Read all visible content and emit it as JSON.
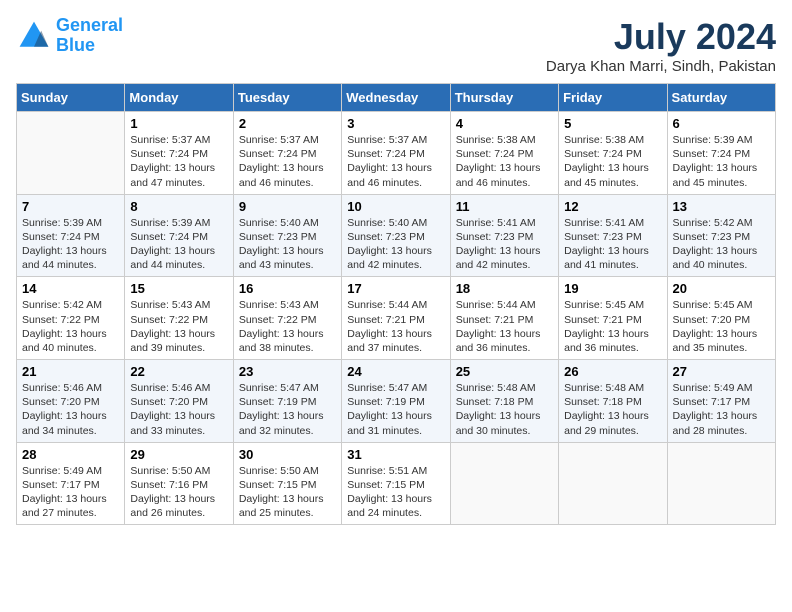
{
  "header": {
    "logo_line1": "General",
    "logo_line2": "Blue",
    "month": "July 2024",
    "location": "Darya Khan Marri, Sindh, Pakistan"
  },
  "weekdays": [
    "Sunday",
    "Monday",
    "Tuesday",
    "Wednesday",
    "Thursday",
    "Friday",
    "Saturday"
  ],
  "weeks": [
    [
      {
        "day": "",
        "info": ""
      },
      {
        "day": "1",
        "info": "Sunrise: 5:37 AM\nSunset: 7:24 PM\nDaylight: 13 hours\nand 47 minutes."
      },
      {
        "day": "2",
        "info": "Sunrise: 5:37 AM\nSunset: 7:24 PM\nDaylight: 13 hours\nand 46 minutes."
      },
      {
        "day": "3",
        "info": "Sunrise: 5:37 AM\nSunset: 7:24 PM\nDaylight: 13 hours\nand 46 minutes."
      },
      {
        "day": "4",
        "info": "Sunrise: 5:38 AM\nSunset: 7:24 PM\nDaylight: 13 hours\nand 46 minutes."
      },
      {
        "day": "5",
        "info": "Sunrise: 5:38 AM\nSunset: 7:24 PM\nDaylight: 13 hours\nand 45 minutes."
      },
      {
        "day": "6",
        "info": "Sunrise: 5:39 AM\nSunset: 7:24 PM\nDaylight: 13 hours\nand 45 minutes."
      }
    ],
    [
      {
        "day": "7",
        "info": "Sunrise: 5:39 AM\nSunset: 7:24 PM\nDaylight: 13 hours\nand 44 minutes."
      },
      {
        "day": "8",
        "info": "Sunrise: 5:39 AM\nSunset: 7:24 PM\nDaylight: 13 hours\nand 44 minutes."
      },
      {
        "day": "9",
        "info": "Sunrise: 5:40 AM\nSunset: 7:23 PM\nDaylight: 13 hours\nand 43 minutes."
      },
      {
        "day": "10",
        "info": "Sunrise: 5:40 AM\nSunset: 7:23 PM\nDaylight: 13 hours\nand 42 minutes."
      },
      {
        "day": "11",
        "info": "Sunrise: 5:41 AM\nSunset: 7:23 PM\nDaylight: 13 hours\nand 42 minutes."
      },
      {
        "day": "12",
        "info": "Sunrise: 5:41 AM\nSunset: 7:23 PM\nDaylight: 13 hours\nand 41 minutes."
      },
      {
        "day": "13",
        "info": "Sunrise: 5:42 AM\nSunset: 7:23 PM\nDaylight: 13 hours\nand 40 minutes."
      }
    ],
    [
      {
        "day": "14",
        "info": "Sunrise: 5:42 AM\nSunset: 7:22 PM\nDaylight: 13 hours\nand 40 minutes."
      },
      {
        "day": "15",
        "info": "Sunrise: 5:43 AM\nSunset: 7:22 PM\nDaylight: 13 hours\nand 39 minutes."
      },
      {
        "day": "16",
        "info": "Sunrise: 5:43 AM\nSunset: 7:22 PM\nDaylight: 13 hours\nand 38 minutes."
      },
      {
        "day": "17",
        "info": "Sunrise: 5:44 AM\nSunset: 7:21 PM\nDaylight: 13 hours\nand 37 minutes."
      },
      {
        "day": "18",
        "info": "Sunrise: 5:44 AM\nSunset: 7:21 PM\nDaylight: 13 hours\nand 36 minutes."
      },
      {
        "day": "19",
        "info": "Sunrise: 5:45 AM\nSunset: 7:21 PM\nDaylight: 13 hours\nand 36 minutes."
      },
      {
        "day": "20",
        "info": "Sunrise: 5:45 AM\nSunset: 7:20 PM\nDaylight: 13 hours\nand 35 minutes."
      }
    ],
    [
      {
        "day": "21",
        "info": "Sunrise: 5:46 AM\nSunset: 7:20 PM\nDaylight: 13 hours\nand 34 minutes."
      },
      {
        "day": "22",
        "info": "Sunrise: 5:46 AM\nSunset: 7:20 PM\nDaylight: 13 hours\nand 33 minutes."
      },
      {
        "day": "23",
        "info": "Sunrise: 5:47 AM\nSunset: 7:19 PM\nDaylight: 13 hours\nand 32 minutes."
      },
      {
        "day": "24",
        "info": "Sunrise: 5:47 AM\nSunset: 7:19 PM\nDaylight: 13 hours\nand 31 minutes."
      },
      {
        "day": "25",
        "info": "Sunrise: 5:48 AM\nSunset: 7:18 PM\nDaylight: 13 hours\nand 30 minutes."
      },
      {
        "day": "26",
        "info": "Sunrise: 5:48 AM\nSunset: 7:18 PM\nDaylight: 13 hours\nand 29 minutes."
      },
      {
        "day": "27",
        "info": "Sunrise: 5:49 AM\nSunset: 7:17 PM\nDaylight: 13 hours\nand 28 minutes."
      }
    ],
    [
      {
        "day": "28",
        "info": "Sunrise: 5:49 AM\nSunset: 7:17 PM\nDaylight: 13 hours\nand 27 minutes."
      },
      {
        "day": "29",
        "info": "Sunrise: 5:50 AM\nSunset: 7:16 PM\nDaylight: 13 hours\nand 26 minutes."
      },
      {
        "day": "30",
        "info": "Sunrise: 5:50 AM\nSunset: 7:15 PM\nDaylight: 13 hours\nand 25 minutes."
      },
      {
        "day": "31",
        "info": "Sunrise: 5:51 AM\nSunset: 7:15 PM\nDaylight: 13 hours\nand 24 minutes."
      },
      {
        "day": "",
        "info": ""
      },
      {
        "day": "",
        "info": ""
      },
      {
        "day": "",
        "info": ""
      }
    ]
  ]
}
